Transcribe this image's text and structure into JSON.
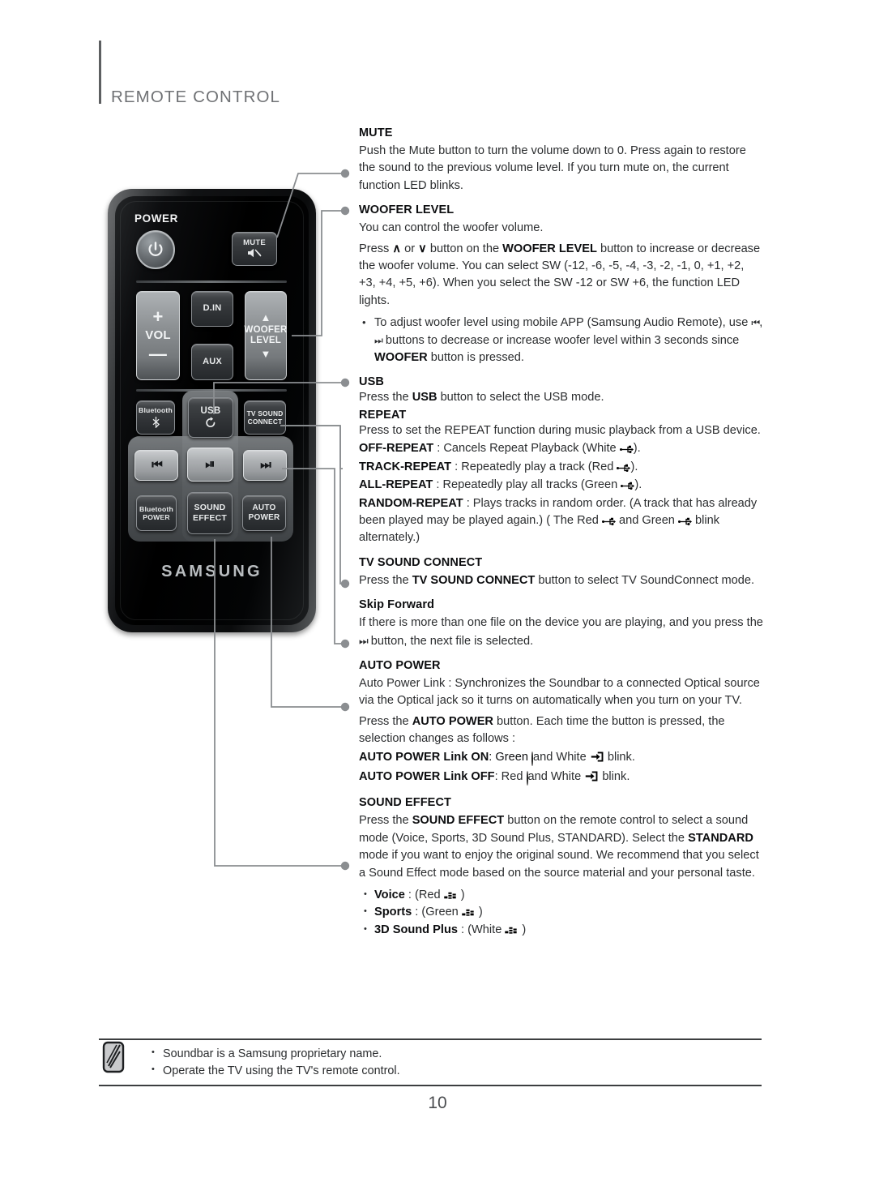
{
  "header": {
    "title": "REMOTE CONTROL"
  },
  "remote": {
    "brand": "SAMSUNG",
    "power_label": "POWER",
    "buttons": [
      {
        "id": "power",
        "label": "",
        "icon": "power-icon"
      },
      {
        "id": "mute",
        "label": "MUTE",
        "icon": "mute-speaker-icon"
      },
      {
        "id": "volume",
        "label": "VOL",
        "icon": "plus-minus-icon"
      },
      {
        "id": "din",
        "label": "D.IN",
        "icon": ""
      },
      {
        "id": "aux",
        "label": "AUX",
        "icon": ""
      },
      {
        "id": "woofer",
        "label": "WOOFER LEVEL",
        "icon": "chevron-up-down-icon"
      },
      {
        "id": "bluetooth",
        "label": "Bluetooth",
        "icon": "bluetooth-icon"
      },
      {
        "id": "usb",
        "label": "USB",
        "icon": "repeat-icon"
      },
      {
        "id": "tvsoundconnect",
        "label": "TV SOUND CONNECT",
        "icon": ""
      },
      {
        "id": "prev",
        "label": "",
        "icon": "skip-back-icon"
      },
      {
        "id": "playpause",
        "label": "",
        "icon": "play-pause-icon"
      },
      {
        "id": "next",
        "label": "",
        "icon": "skip-forward-icon"
      },
      {
        "id": "bluetooth-power",
        "label": "Bluetooth POWER",
        "icon": ""
      },
      {
        "id": "sound-effect",
        "label": "SOUND EFFECT",
        "icon": ""
      },
      {
        "id": "auto-power",
        "label": "AUTO POWER",
        "icon": ""
      }
    ]
  },
  "sections": {
    "mute": {
      "heading": "MUTE",
      "body": "Push the Mute button to turn the volume down to 0. Press again to restore the sound to the previous volume level. If you turn mute on, the current function LED blinks."
    },
    "woofer": {
      "heading": "WOOFER LEVEL",
      "p1": "You can control the woofer volume.",
      "p2_a": "Press ",
      "p2_up": "∧",
      "p2_b": " or ",
      "p2_dn": "∨",
      "p2_c": " button on the ",
      "p2_bold": "WOOFER LEVEL",
      "p2_d": " button to increase or decrease the woofer volume. You can select SW (-12, -6, -5, -4, -3, -2, -1, 0, +1, +2, +3, +4, +5, +6). When you select the SW -12  or SW +6, the function LED lights.",
      "bullet_a": "To adjust woofer level using mobile APP (Samsung Audio Remote), use ",
      "bullet_b": " buttons to decrease or increase woofer level within 3 seconds since ",
      "bullet_bold": "WOOFER",
      "bullet_c": " button is pressed."
    },
    "usb": {
      "heading": "USB",
      "p_a": "Press the ",
      "p_bold": "USB",
      "p_b": " button to select the USB mode."
    },
    "repeat": {
      "heading": "REPEAT",
      "intro": "Press to set the REPEAT function during music playback from a USB device.",
      "items": [
        {
          "term": "OFF-REPEAT",
          "text": " : Cancels Repeat Playback (White ",
          "tail": ")."
        },
        {
          "term": "TRACK-REPEAT",
          "text": " : Repeatedly play a track (Red ",
          "tail": ")."
        },
        {
          "term": "ALL-REPEAT",
          "text": " : Repeatedly play all tracks (Green ",
          "tail": ")."
        }
      ],
      "random_term": "RANDOM-REPEAT",
      "random_a": " : Plays tracks in random order. (A track that has already been played may be played again.) ( The Red ",
      "random_b": " and Green ",
      "random_c": " blink alternately.)"
    },
    "tv_sound_connect": {
      "heading": "TV SOUND CONNECT",
      "p_a": "Press the ",
      "p_bold": "TV SOUND CONNECT",
      "p_b": " button to select TV SoundConnect mode."
    },
    "skip_forward": {
      "heading": "Skip Forward",
      "p_a": "If there is more than one file on the device you are playing, and you press the ",
      "p_b": " button, the next file is selected."
    },
    "auto_power": {
      "heading": "AUTO POWER",
      "p1": "Auto Power Link : Synchronizes the Soundbar to a connected Optical source via the Optical jack so it turns on automatically when you turn on your TV.",
      "p2_a": "Press the ",
      "p2_bold": "AUTO POWER",
      "p2_b": " button. Each time the button is pressed, the selection changes as follows :",
      "on_term": "AUTO POWER Link ON",
      "on_a": ": Green ",
      "on_b": " and White ",
      "on_c": " blink.",
      "off_term": "AUTO POWER Link OFF",
      "off_a": ": Red ",
      "off_b": " and White ",
      "off_c": " blink."
    },
    "sound_effect": {
      "heading": "SOUND EFFECT",
      "p_a": "Press the ",
      "p_bold1": "SOUND EFFECT",
      "p_b": " button on the remote control to select a sound mode (Voice, Sports, 3D Sound Plus, STANDARD). Select the ",
      "p_bold2": "STANDARD",
      "p_c": " mode if you want to enjoy the original sound. We recommend that you select a Sound Effect mode based on the source material and your personal taste.",
      "modes": [
        {
          "name": "Voice",
          "text": " : (Red ",
          "tail": " )"
        },
        {
          "name": "Sports",
          "text": " : (Green ",
          "tail": " )"
        },
        {
          "name": "3D Sound Plus",
          "text": " : (White ",
          "tail": " )"
        }
      ]
    }
  },
  "note": {
    "icon": "note-pencil-icon",
    "items": [
      "Soundbar is a Samsung proprietary name.",
      "Operate the TV using the TV's remote control."
    ]
  },
  "page_number": "10",
  "colors": {
    "rule": "#3c3e40",
    "header_text": "#6f7174",
    "body_text": "#2b2d2f",
    "leader": "#8b8e91"
  }
}
